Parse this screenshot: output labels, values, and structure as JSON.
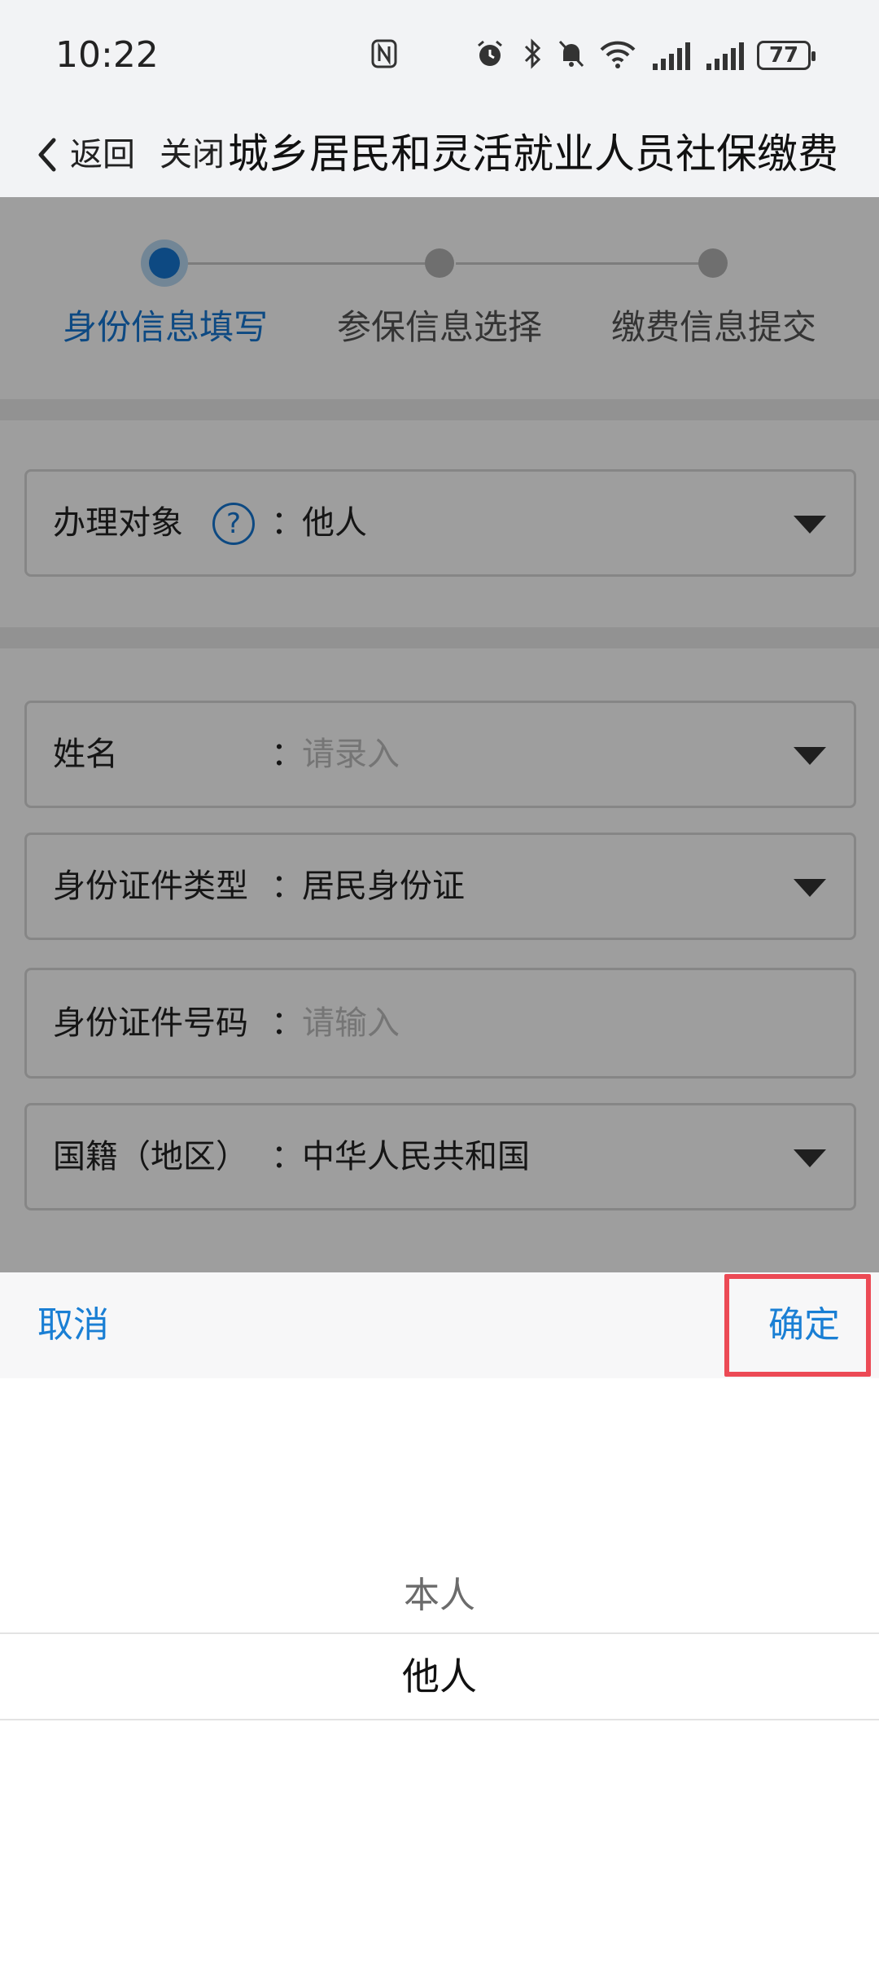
{
  "status_bar": {
    "time": "10:22",
    "battery": "77",
    "icons": [
      "nfc-icon",
      "alarm-icon",
      "bluetooth-icon",
      "mute-icon",
      "wifi-icon",
      "signal-icon",
      "signal-icon",
      "battery-icon"
    ]
  },
  "nav": {
    "back_label": "返回",
    "close_label": "关闭",
    "title": "城乡居民和灵活就业人员社保缴费"
  },
  "steps": [
    {
      "label": "身份信息填写",
      "active": true
    },
    {
      "label": "参保信息选择",
      "active": false
    },
    {
      "label": "缴费信息提交",
      "active": false
    }
  ],
  "form": {
    "handler": {
      "label": "办理对象",
      "colon": "：",
      "value": "他人",
      "help": "?"
    },
    "name": {
      "label": "姓名",
      "colon": "：",
      "placeholder": "请录入"
    },
    "id_type": {
      "label": "身份证件类型",
      "colon": "：",
      "value": "居民身份证"
    },
    "id_number": {
      "label": "身份证件号码",
      "colon": "：",
      "placeholder": "请输入"
    },
    "nationality": {
      "label": "国籍（地区）",
      "colon": "：",
      "value": "中华人民共和国"
    }
  },
  "picker": {
    "cancel_label": "取消",
    "confirm_label": "确定",
    "options": [
      "本人",
      "他人"
    ],
    "selected": "他人"
  },
  "colors": {
    "accent": "#1677d2",
    "highlight_box": "#ec4a55"
  }
}
